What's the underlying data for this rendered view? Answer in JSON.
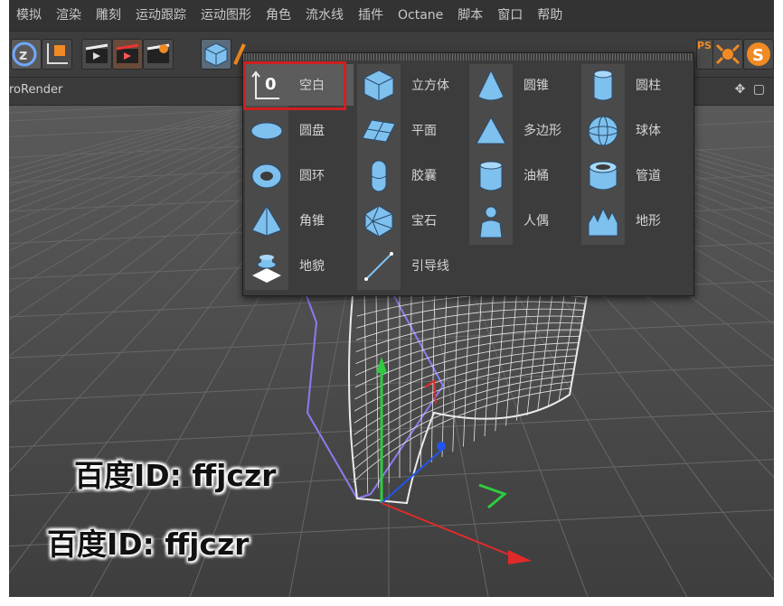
{
  "menubar": {
    "items": [
      "模拟",
      "渲染",
      "雕刻",
      "运动跟踪",
      "运动图形",
      "角色",
      "流水线",
      "插件",
      "Octane",
      "脚本",
      "窗口",
      "帮助"
    ]
  },
  "toolbar": {
    "psr_label": "PSR"
  },
  "viewport": {
    "label": "roRender",
    "nav_glyph": "✥ ▢"
  },
  "object_popup": {
    "columns": [
      [
        {
          "label": "空白",
          "icon": "null-icon",
          "selected": true
        },
        {
          "label": "圆盘",
          "icon": "disc-icon"
        },
        {
          "label": "圆环",
          "icon": "torus-icon"
        },
        {
          "label": "角锥",
          "icon": "pyramid-icon"
        },
        {
          "label": "地貌",
          "icon": "landscape-icon"
        }
      ],
      [
        {
          "label": "立方体",
          "icon": "cube-icon"
        },
        {
          "label": "平面",
          "icon": "plane-icon"
        },
        {
          "label": "胶囊",
          "icon": "capsule-icon"
        },
        {
          "label": "宝石",
          "icon": "gem-icon"
        },
        {
          "label": "引导线",
          "icon": "guide-icon"
        }
      ],
      [
        {
          "label": "圆锥",
          "icon": "cone-icon"
        },
        {
          "label": "多边形",
          "icon": "polygon-icon"
        },
        {
          "label": "油桶",
          "icon": "oil-tank-icon"
        },
        {
          "label": "人偶",
          "icon": "figure-icon"
        }
      ],
      [
        {
          "label": "圆柱",
          "icon": "cylinder-icon"
        },
        {
          "label": "球体",
          "icon": "sphere-icon"
        },
        {
          "label": "管道",
          "icon": "tube-icon"
        },
        {
          "label": "地形",
          "icon": "terrain-icon"
        }
      ]
    ]
  },
  "watermarks": [
    "百度ID: ffjczr",
    "百度ID: ffjczr"
  ],
  "colors": {
    "selection_border": "#d01f1f",
    "primitive_blue": "#7ec0ee",
    "axis_x": "#e02a2a",
    "axis_y": "#2ecc40",
    "axis_z": "#2255ee",
    "spline": "#8a7cf0"
  }
}
